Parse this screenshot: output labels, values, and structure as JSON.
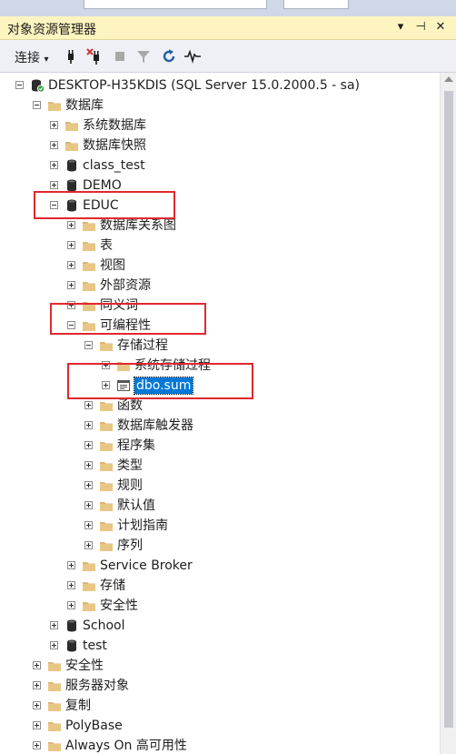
{
  "window": {
    "title": "对象资源管理器",
    "title_buttons": [
      "▾",
      "⊣",
      "✕"
    ]
  },
  "toolbar": {
    "connect_label": "连接",
    "connect_dropdown": "▾",
    "icons": [
      "connect-plug-icon",
      "disconnect-icon",
      "stop-icon",
      "filter-icon",
      "refresh-icon",
      "activity-monitor-icon"
    ]
  },
  "tree": {
    "nodes": [
      {
        "label": "DESKTOP-H35KDIS (SQL Server 15.0.2000.5 - sa)",
        "level": 0,
        "icon": "server",
        "expanded": true
      },
      {
        "label": "数据库",
        "level": 1,
        "icon": "folder",
        "expanded": true
      },
      {
        "label": "系统数据库",
        "level": 2,
        "icon": "folder",
        "expanded": false
      },
      {
        "label": "数据库快照",
        "level": 2,
        "icon": "folder",
        "expanded": false
      },
      {
        "label": "class_test",
        "level": 2,
        "icon": "database",
        "expanded": false
      },
      {
        "label": "DEMO",
        "level": 2,
        "icon": "database",
        "expanded": false
      },
      {
        "label": "EDUC",
        "level": 2,
        "icon": "database",
        "expanded": true
      },
      {
        "label": "数据库关系图",
        "level": 3,
        "icon": "folder",
        "expanded": false
      },
      {
        "label": "表",
        "level": 3,
        "icon": "folder",
        "expanded": false
      },
      {
        "label": "视图",
        "level": 3,
        "icon": "folder",
        "expanded": false
      },
      {
        "label": "外部资源",
        "level": 3,
        "icon": "folder",
        "expanded": false
      },
      {
        "label": "同义词",
        "level": 3,
        "icon": "folder",
        "expanded": false
      },
      {
        "label": "可编程性",
        "level": 3,
        "icon": "folder",
        "expanded": true
      },
      {
        "label": "存储过程",
        "level": 4,
        "icon": "folder",
        "expanded": true
      },
      {
        "label": "系统存储过程",
        "level": 5,
        "icon": "folder",
        "expanded": false
      },
      {
        "label": "dbo.sum",
        "level": 5,
        "icon": "procedure",
        "expanded": false,
        "selected": true
      },
      {
        "label": "函数",
        "level": 4,
        "icon": "folder",
        "expanded": false
      },
      {
        "label": "数据库触发器",
        "level": 4,
        "icon": "folder",
        "expanded": false
      },
      {
        "label": "程序集",
        "level": 4,
        "icon": "folder",
        "expanded": false
      },
      {
        "label": "类型",
        "level": 4,
        "icon": "folder",
        "expanded": false
      },
      {
        "label": "规则",
        "level": 4,
        "icon": "folder",
        "expanded": false
      },
      {
        "label": "默认值",
        "level": 4,
        "icon": "folder",
        "expanded": false
      },
      {
        "label": "计划指南",
        "level": 4,
        "icon": "folder",
        "expanded": false
      },
      {
        "label": "序列",
        "level": 4,
        "icon": "folder",
        "expanded": false
      },
      {
        "label": "Service Broker",
        "level": 3,
        "icon": "folder",
        "expanded": false
      },
      {
        "label": "存储",
        "level": 3,
        "icon": "folder",
        "expanded": false
      },
      {
        "label": "安全性",
        "level": 3,
        "icon": "folder",
        "expanded": false
      },
      {
        "label": "School",
        "level": 2,
        "icon": "database",
        "expanded": false
      },
      {
        "label": "test",
        "level": 2,
        "icon": "database",
        "expanded": false
      },
      {
        "label": "安全性",
        "level": 1,
        "icon": "folder",
        "expanded": false
      },
      {
        "label": "服务器对象",
        "level": 1,
        "icon": "folder",
        "expanded": false
      },
      {
        "label": "复制",
        "level": 1,
        "icon": "folder",
        "expanded": false
      },
      {
        "label": "PolyBase",
        "level": 1,
        "icon": "folder",
        "expanded": false
      },
      {
        "label": "Always On 高可用性",
        "level": 1,
        "icon": "folder",
        "expanded": false
      }
    ]
  },
  "colors": {
    "title_bar": "#fdf4bf",
    "selection": "#0078d7",
    "highlight_box": "#e0282e",
    "folder": "#dcb67a"
  }
}
